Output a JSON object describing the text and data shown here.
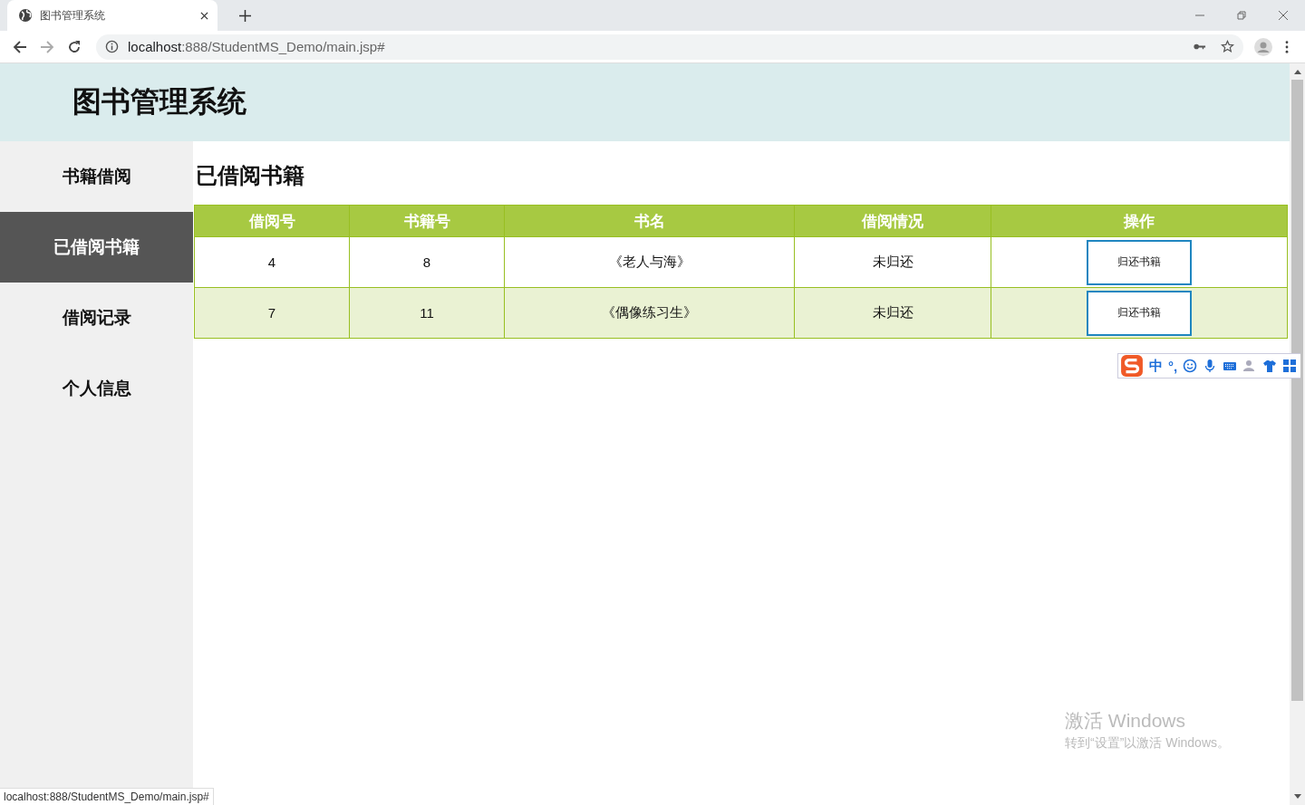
{
  "browser": {
    "tab_title": "图书管理系统",
    "url_host": "localhost",
    "url_rest": ":888/StudentMS_Demo/main.jsp#",
    "status_url": "localhost:888/StudentMS_Demo/main.jsp#"
  },
  "header": {
    "title": "图书管理系统"
  },
  "sidebar": {
    "items": [
      {
        "label": "书籍借阅",
        "selected": false
      },
      {
        "label": "已借阅书籍",
        "selected": true
      },
      {
        "label": "借阅记录",
        "selected": false
      },
      {
        "label": "个人信息",
        "selected": false
      }
    ]
  },
  "section_title": "已借阅书籍",
  "table": {
    "columns": [
      "借阅号",
      "书籍号",
      "书名",
      "借阅情况",
      "操作"
    ],
    "rows": [
      {
        "cells": [
          "4",
          "8",
          "《老人与海》",
          "未归还"
        ],
        "action": "归还书籍"
      },
      {
        "cells": [
          "7",
          "11",
          "《偶像练习生》",
          "未归还"
        ],
        "action": "归还书籍"
      }
    ]
  },
  "ime": {
    "mode": "中",
    "punctuation": "°,"
  },
  "activation": {
    "title": "激活 Windows",
    "subtitle": "转到“设置”以激活 Windows。"
  }
}
